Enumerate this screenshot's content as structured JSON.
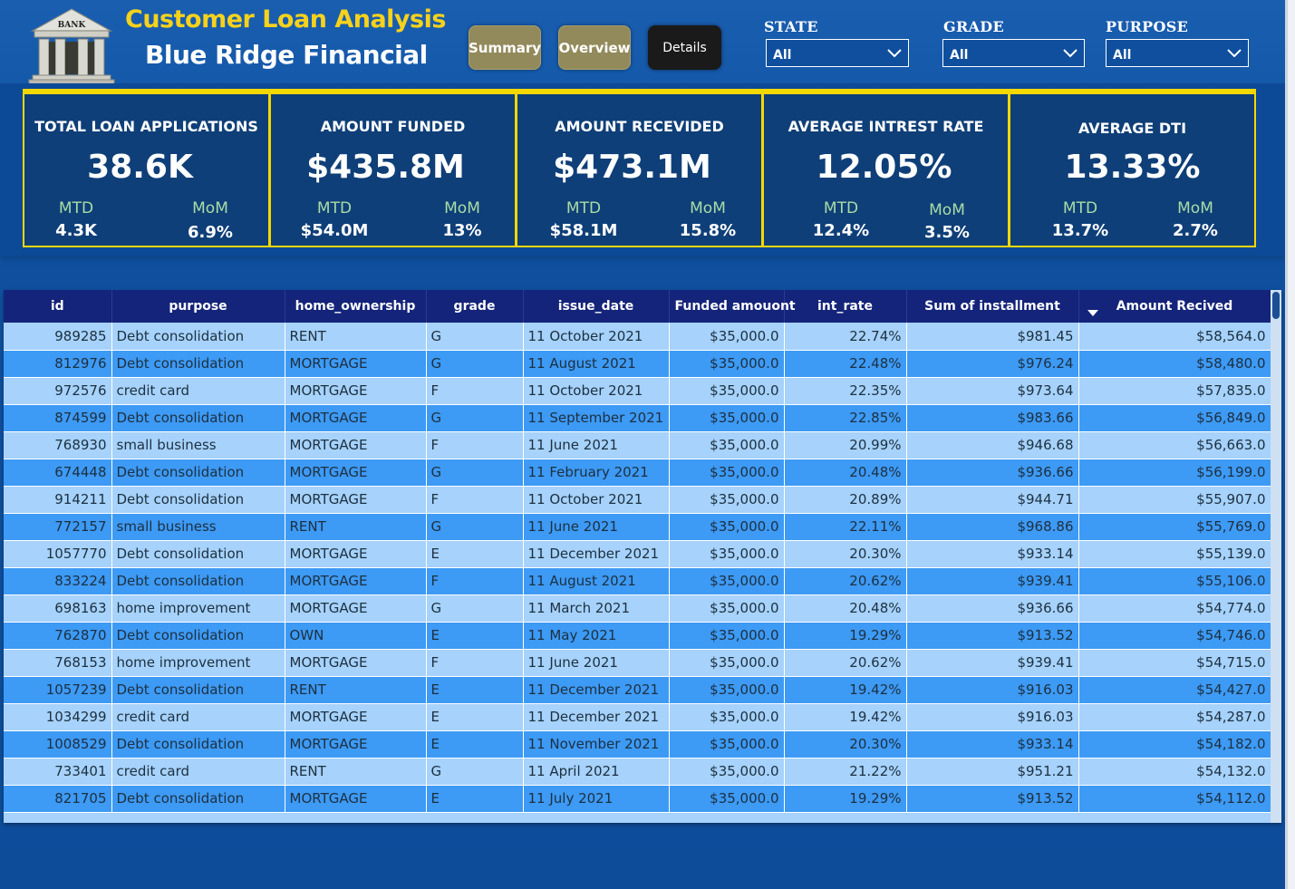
{
  "header": {
    "title": "Customer Loan Analysis",
    "subtitle": "Blue Ridge Financial",
    "logo_text": "BANK",
    "logo_icon": "bank-building-icon"
  },
  "nav": {
    "summary": "Summary",
    "overview": "Overview",
    "details": "Details"
  },
  "filters": {
    "state": {
      "label": "STATE",
      "value": "All"
    },
    "grade": {
      "label": "GRADE",
      "value": "All"
    },
    "purpose": {
      "label": "PURPOSE",
      "value": "All"
    }
  },
  "kpis": [
    {
      "title": "TOTAL LOAN APPLICATIONS",
      "value": "38.6K",
      "mtd_label": "MTD",
      "mtd": "4.3K",
      "mom_label": "MoM",
      "mom": "6.9%"
    },
    {
      "title": "AMOUNT FUNDED",
      "value": "$435.8M",
      "mtd_label": "MTD",
      "mtd": "$54.0M",
      "mom_label": "MoM",
      "mom": "13%"
    },
    {
      "title": "AMOUNT RECEVIDED",
      "value": "$473.1M",
      "mtd_label": "MTD",
      "mtd": "$58.1M",
      "mom_label": "MoM",
      "mom": "15.8%"
    },
    {
      "title": "AVERAGE INTREST RATE",
      "value": "12.05%",
      "mtd_label": "MTD",
      "mtd": "12.4%",
      "mom_label": "MoM",
      "mom": "3.5%"
    },
    {
      "title": "AVERAGE DTI",
      "value": "13.33%",
      "mtd_label": "MTD",
      "mtd": "13.7%",
      "mom_label": "MoM",
      "mom": "2.7%"
    }
  ],
  "table": {
    "columns": [
      "id",
      "purpose",
      "home_ownership",
      "grade",
      "issue_date",
      "Funded amouont",
      "int_rate",
      "Sum of installment",
      "Amount Recived"
    ],
    "sort_indicator": "sort-descending-icon",
    "rows": [
      [
        "989285",
        "Debt consolidation",
        "RENT",
        "G",
        "11 October 2021",
        "$35,000.0",
        "22.74%",
        "$981.45",
        "$58,564.0"
      ],
      [
        "812976",
        "Debt consolidation",
        "MORTGAGE",
        "G",
        "11 August 2021",
        "$35,000.0",
        "22.48%",
        "$976.24",
        "$58,480.0"
      ],
      [
        "972576",
        "credit card",
        "MORTGAGE",
        "F",
        "11 October 2021",
        "$35,000.0",
        "22.35%",
        "$973.64",
        "$57,835.0"
      ],
      [
        "874599",
        "Debt consolidation",
        "MORTGAGE",
        "G",
        "11 September 2021",
        "$35,000.0",
        "22.85%",
        "$983.66",
        "$56,849.0"
      ],
      [
        "768930",
        "small business",
        "MORTGAGE",
        "F",
        "11 June 2021",
        "$35,000.0",
        "20.99%",
        "$946.68",
        "$56,663.0"
      ],
      [
        "674448",
        "Debt consolidation",
        "MORTGAGE",
        "G",
        "11 February 2021",
        "$35,000.0",
        "20.48%",
        "$936.66",
        "$56,199.0"
      ],
      [
        "914211",
        "Debt consolidation",
        "MORTGAGE",
        "F",
        "11 October 2021",
        "$35,000.0",
        "20.89%",
        "$944.71",
        "$55,907.0"
      ],
      [
        "772157",
        "small business",
        "RENT",
        "G",
        "11 June 2021",
        "$35,000.0",
        "22.11%",
        "$968.86",
        "$55,769.0"
      ],
      [
        "1057770",
        "Debt consolidation",
        "MORTGAGE",
        "E",
        "11 December 2021",
        "$35,000.0",
        "20.30%",
        "$933.14",
        "$55,139.0"
      ],
      [
        "833224",
        "Debt consolidation",
        "MORTGAGE",
        "F",
        "11 August 2021",
        "$35,000.0",
        "20.62%",
        "$939.41",
        "$55,106.0"
      ],
      [
        "698163",
        "home improvement",
        "MORTGAGE",
        "G",
        "11 March 2021",
        "$35,000.0",
        "20.48%",
        "$936.66",
        "$54,774.0"
      ],
      [
        "762870",
        "Debt consolidation",
        "OWN",
        "E",
        "11 May 2021",
        "$35,000.0",
        "19.29%",
        "$913.52",
        "$54,746.0"
      ],
      [
        "768153",
        "home improvement",
        "MORTGAGE",
        "F",
        "11 June 2021",
        "$35,000.0",
        "20.62%",
        "$939.41",
        "$54,715.0"
      ],
      [
        "1057239",
        "Debt consolidation",
        "RENT",
        "E",
        "11 December 2021",
        "$35,000.0",
        "19.42%",
        "$916.03",
        "$54,427.0"
      ],
      [
        "1034299",
        "credit card",
        "MORTGAGE",
        "E",
        "11 December 2021",
        "$35,000.0",
        "19.42%",
        "$916.03",
        "$54,287.0"
      ],
      [
        "1008529",
        "Debt consolidation",
        "MORTGAGE",
        "E",
        "11 November 2021",
        "$35,000.0",
        "20.30%",
        "$933.14",
        "$54,182.0"
      ],
      [
        "733401",
        "credit card",
        "RENT",
        "G",
        "11 April 2021",
        "$35,000.0",
        "21.22%",
        "$951.21",
        "$54,132.0"
      ],
      [
        "821705",
        "Debt consolidation",
        "MORTGAGE",
        "E",
        "11 July 2021",
        "$35,000.0",
        "19.29%",
        "$913.52",
        "$54,112.0"
      ]
    ]
  },
  "colors": {
    "background": "#0f4f9e",
    "title_accent": "#f7d21c",
    "card_border": "#f5d800",
    "card_bg": "#0f3f78",
    "kpi_sub_label": "#a8dda6",
    "table_header": "#14247a",
    "row_light": "#a6d2fb",
    "row_dark": "#3d9af5",
    "nav_gold": "#938a5b"
  }
}
